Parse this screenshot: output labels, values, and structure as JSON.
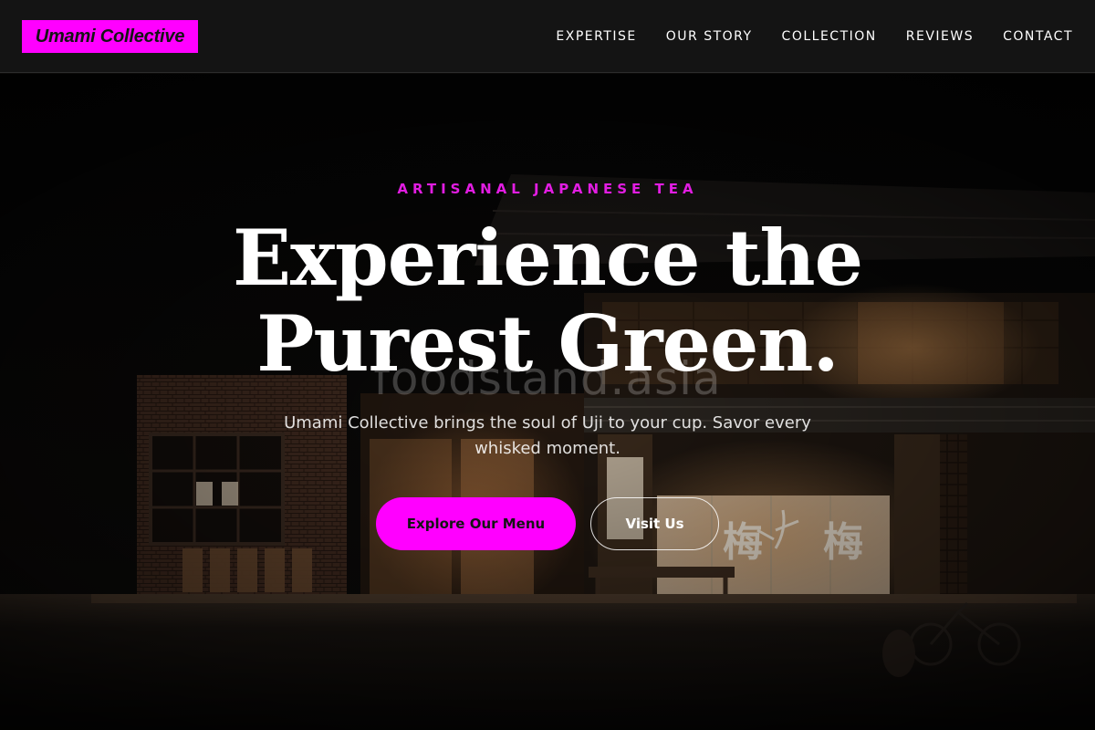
{
  "header": {
    "logo_text": "Umami Collective",
    "nav": [
      {
        "label": "EXPERTISE"
      },
      {
        "label": "OUR STORY"
      },
      {
        "label": "COLLECTION"
      },
      {
        "label": "REVIEWS"
      },
      {
        "label": "CONTACT"
      }
    ]
  },
  "hero": {
    "eyebrow": "ARTISANAL JAPANESE TEA",
    "headline_line1": "Experience the",
    "headline_line2": "Purest Green.",
    "subtext": "Umami Collective brings the soul of Uji to your cup. Savor every whisked moment.",
    "primary_button": "Explore Our Menu",
    "secondary_button": "Visit Us",
    "watermark": "foodstand.asia",
    "noren_characters": [
      "梅",
      "梅"
    ]
  },
  "colors": {
    "accent": "#ff00ff",
    "header_bg": "#141414",
    "eyebrow": "#e21de2",
    "text": "#ffffff"
  }
}
